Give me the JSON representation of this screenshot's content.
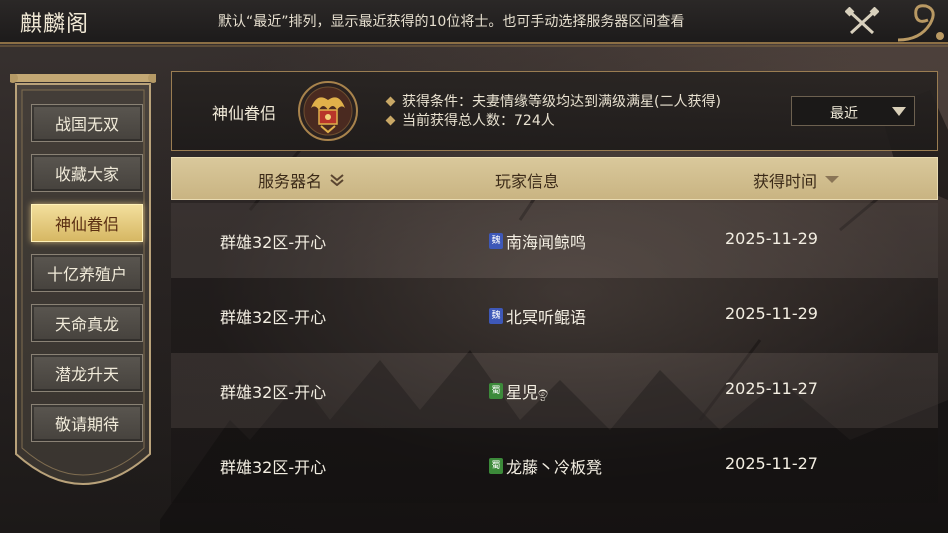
{
  "header": {
    "title": "麒麟阁",
    "hint": "默认“最近”排列，显示最近获得的10位将士。也可手动选择服务器区间查看"
  },
  "sidebar": {
    "items": [
      {
        "label": "战国无双",
        "active": false
      },
      {
        "label": "收藏大家",
        "active": false
      },
      {
        "label": "神仙眷侣",
        "active": true
      },
      {
        "label": "十亿养殖户",
        "active": false
      },
      {
        "label": "天命真龙",
        "active": false
      },
      {
        "label": "潜龙升天",
        "active": false
      },
      {
        "label": "敬请期待",
        "active": false
      }
    ]
  },
  "info": {
    "name": "神仙眷侣",
    "condition": "获得条件：夫妻情缘等级均达到满级满星(二人获得)",
    "count": "当前获得总人数：724人",
    "filter_value": "最近"
  },
  "table": {
    "headers": {
      "server": "服务器名",
      "player": "玩家信息",
      "time": "获得时间"
    },
    "rows": [
      {
        "server": "群雄32区-开心",
        "faction": "魏",
        "faction_color": "#3e58b8",
        "player": "南海闻鲸鸣",
        "time": "2025-11-29"
      },
      {
        "server": "群雄32区-开心",
        "faction": "魏",
        "faction_color": "#3e58b8",
        "player": "北冥听鲲语",
        "time": "2025-11-29"
      },
      {
        "server": "群雄32区-开心",
        "faction": "蜀",
        "faction_color": "#3c8a3a",
        "player": "星児ඉ",
        "time": "2025-11-27"
      },
      {
        "server": "群雄32区-开心",
        "faction": "蜀",
        "faction_color": "#3c8a3a",
        "player": "龙藤丶冷板凳",
        "time": "2025-11-27"
      }
    ]
  },
  "colors": {
    "accent_gold": "#c9a866",
    "active_tab": "#e8cd80",
    "table_head": "#d2bf8e"
  },
  "icons": {
    "close": "crossed-swords-icon",
    "emblem": "lovers-emblem-icon",
    "dropdown": "triangle-down-icon",
    "sort": "chevron-down-icon"
  }
}
